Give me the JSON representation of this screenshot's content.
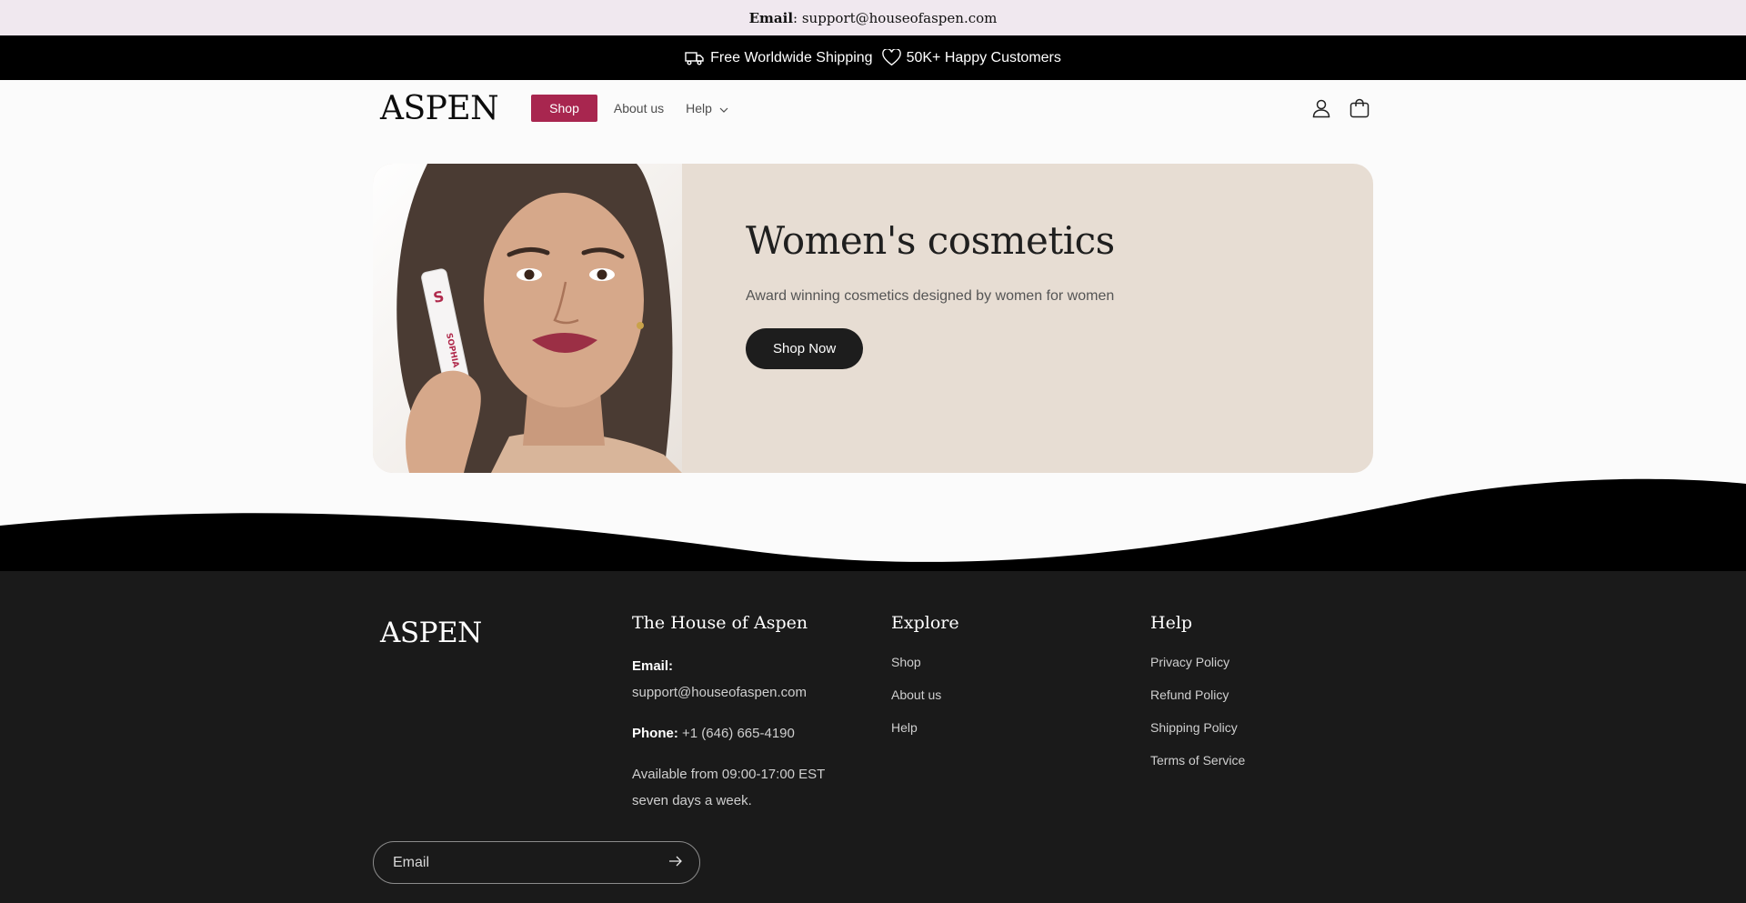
{
  "announcement": {
    "label": "Email",
    "value": "support@houseofaspen.com"
  },
  "shipping_bar": {
    "shipping_text": "Free Worldwide Shipping",
    "customers_text": "50K+ Happy Customers"
  },
  "header": {
    "logo": "ASPEN",
    "nav": {
      "shop": "Shop",
      "about": "About us",
      "help": "Help"
    }
  },
  "hero": {
    "title": "Women's cosmetics",
    "subtitle": "Award winning cosmetics designed by women for women",
    "button": "Shop Now",
    "product_text": "SOPHIA"
  },
  "footer": {
    "logo": "ASPEN",
    "contact": {
      "heading": "The House of Aspen",
      "email_label": "Email:",
      "email_value": "support@houseofaspen.com",
      "phone_label": "Phone:",
      "phone_value": " +1 (646) 665-4190",
      "hours_line1": "Available from 09:00-17:00 EST",
      "hours_line2": "seven days a week."
    },
    "explore": {
      "heading": "Explore",
      "links": [
        "Shop",
        "About us",
        "Help"
      ]
    },
    "help": {
      "heading": "Help",
      "links": [
        "Privacy Policy",
        "Refund Policy",
        "Shipping Policy",
        "Terms of Service"
      ]
    },
    "newsletter": {
      "placeholder": "Email"
    }
  },
  "colors": {
    "announcement_bg": "#f0e8ef",
    "brand_accent": "#a8264f",
    "hero_bg": "#e7ddd3",
    "footer_bg": "#1a1a1a"
  }
}
